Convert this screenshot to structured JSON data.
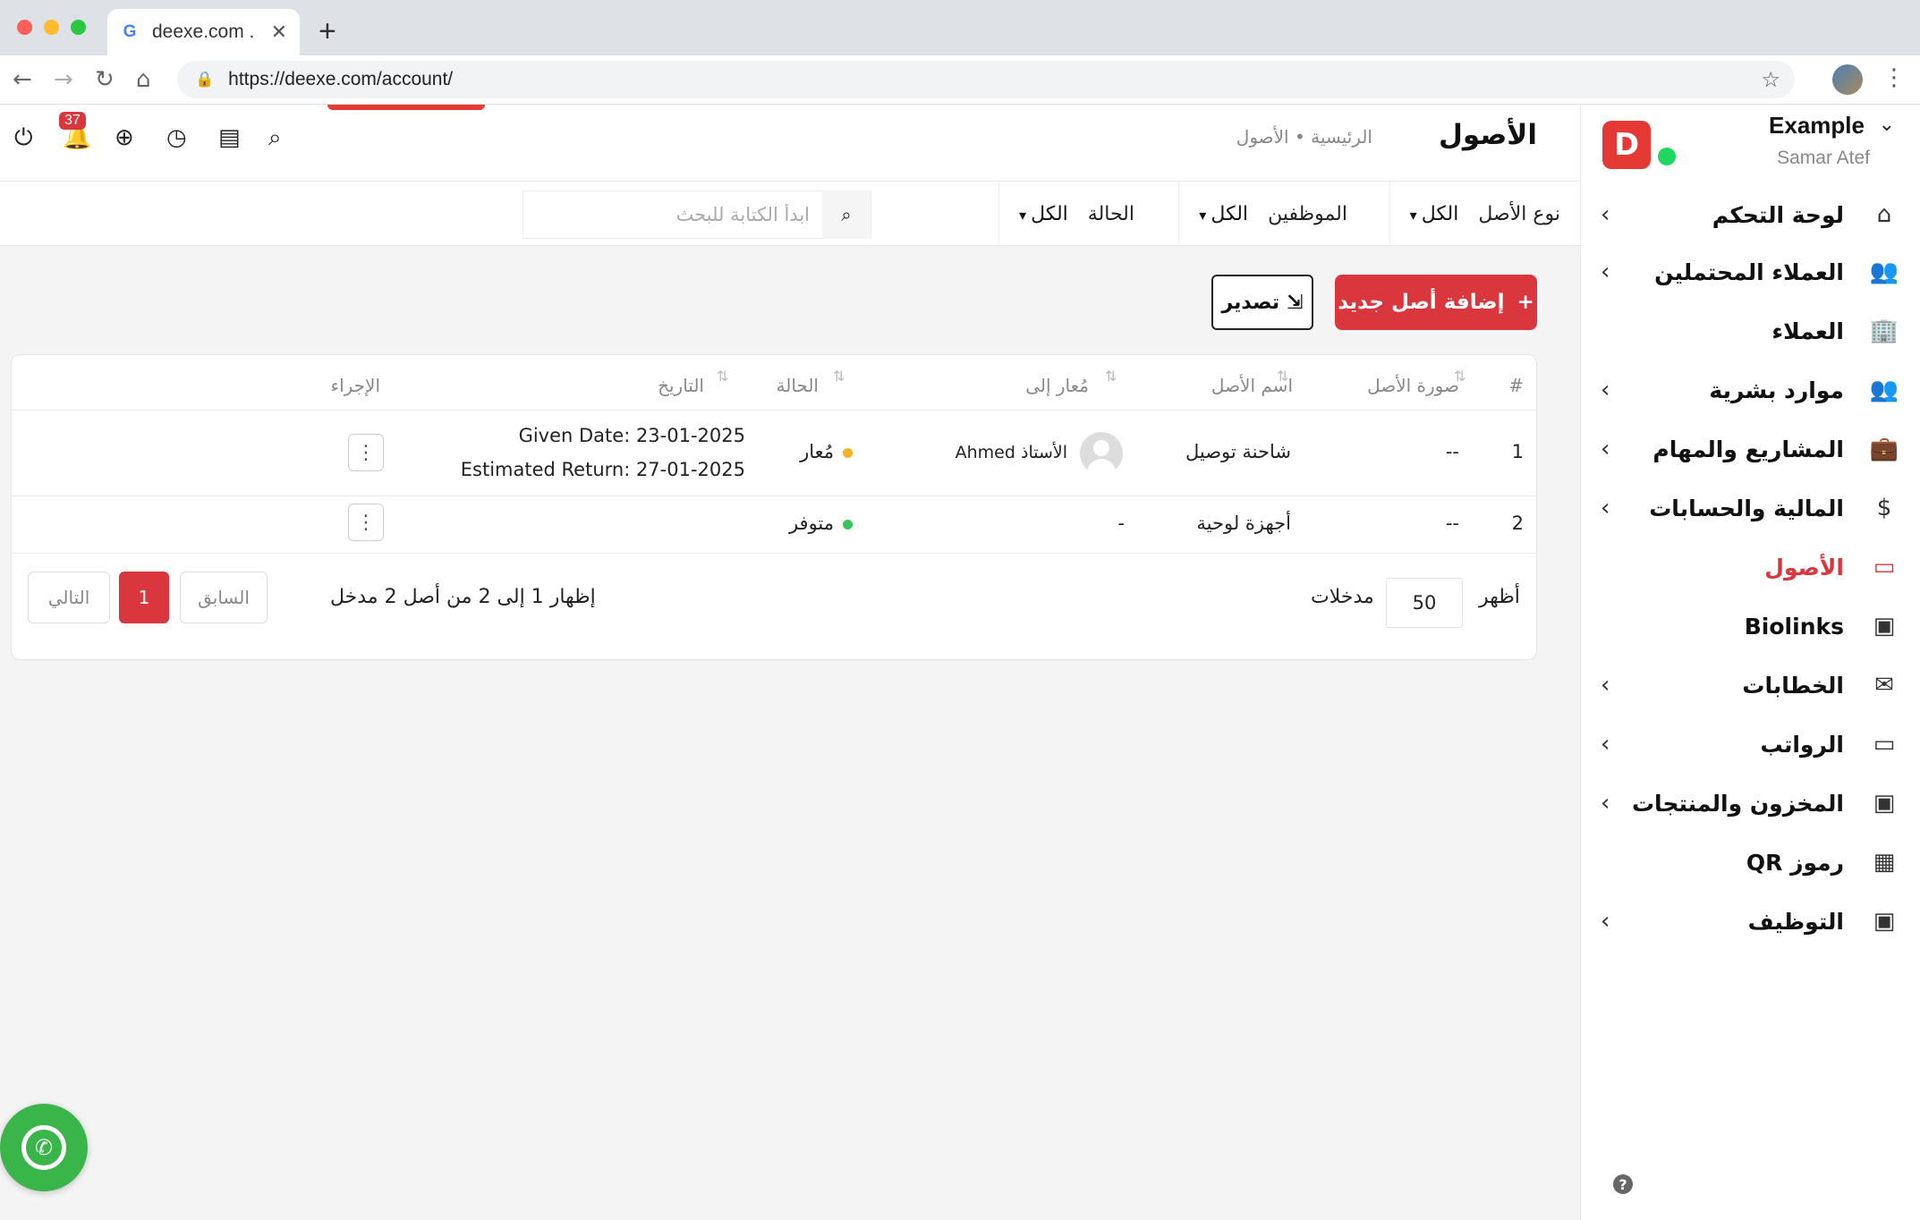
{
  "browser": {
    "tab_title": "deexe.com .",
    "tab_favicon": "G",
    "url": "https://deexe.com/account/"
  },
  "brand": {
    "name": "Example",
    "user": "Samar Atef",
    "logo_letter": "D"
  },
  "sidebar": {
    "items": [
      {
        "label": "لوحة التحكم",
        "icon": "home-icon",
        "glyph": "⌂",
        "chevron": true
      },
      {
        "label": "العملاء المحتملين",
        "icon": "users-icon",
        "glyph": "👥",
        "chevron": true
      },
      {
        "label": "العملاء",
        "icon": "building-icon",
        "glyph": "🏢",
        "chevron": false
      },
      {
        "label": "موارد بشرية",
        "icon": "people-icon",
        "glyph": "👥",
        "chevron": true
      },
      {
        "label": "المشاريع والمهام",
        "icon": "briefcase-icon",
        "glyph": "💼",
        "chevron": true
      },
      {
        "label": "المالية والحسابات",
        "icon": "dollar-icon",
        "glyph": "$",
        "chevron": true
      },
      {
        "label": "الأصول",
        "icon": "monitor-icon",
        "glyph": "▭",
        "chevron": false,
        "active": true
      },
      {
        "label": "Biolinks",
        "icon": "badge-icon",
        "glyph": "▣",
        "chevron": false
      },
      {
        "label": "الخطابات",
        "icon": "envelope-icon",
        "glyph": "✉",
        "chevron": true
      },
      {
        "label": "الرواتب",
        "icon": "wallet-icon",
        "glyph": "▭",
        "chevron": true
      },
      {
        "label": "المخزون والمنتجات",
        "icon": "box-icon",
        "glyph": "▣",
        "chevron": true
      },
      {
        "label": "رموز QR",
        "icon": "qr-icon",
        "glyph": "▦",
        "chevron": false
      },
      {
        "label": "التوظيف",
        "icon": "id-icon",
        "glyph": "▣",
        "chevron": true
      }
    ]
  },
  "header": {
    "title": "الأصول",
    "breadcrumb": "الرئيسية • الأصول",
    "notifications": "37"
  },
  "filters": {
    "asset_type_label": "نوع الأصل",
    "asset_type_value": "الكل",
    "employees_label": "الموظفين",
    "employees_value": "الكل",
    "status_label": "الحالة",
    "status_value": "الكل",
    "search_placeholder": "ابدأ الكتابة للبحث"
  },
  "actions": {
    "add_label": "إضافة أصل جديد",
    "export_label": "تصدير"
  },
  "table": {
    "headers": {
      "index": "#",
      "image": "صورة الأصل",
      "name": "اسم الأصل",
      "assigned": "مُعار إلى",
      "status": "الحالة",
      "date": "التاريخ",
      "action": "الإجراء"
    },
    "rows": [
      {
        "index": "1",
        "image": "--",
        "name": "شاحنة توصيل",
        "assigned": "الأستاذ Ahmed",
        "status": "مُعار",
        "status_color": "#f0b429",
        "date_given": "Given Date: 23-01-2025",
        "date_return": "Estimated Return: 27-01-2025"
      },
      {
        "index": "2",
        "image": "--",
        "name": "أجهزة لوحية",
        "assigned": "-",
        "status": "متوفر",
        "status_color": "#35c759",
        "date_given": "",
        "date_return": ""
      }
    ]
  },
  "pagination": {
    "show_label": "أظهر",
    "entries_label": "مدخلات",
    "page_length": "50",
    "info": "إظهار 1 إلى 2 من أصل 2 مدخل",
    "prev": "السابق",
    "current": "1",
    "next": "التالي"
  },
  "colors": {
    "accent": "#d9363e",
    "online": "#1ed760",
    "whatsapp": "#3ab54a"
  }
}
